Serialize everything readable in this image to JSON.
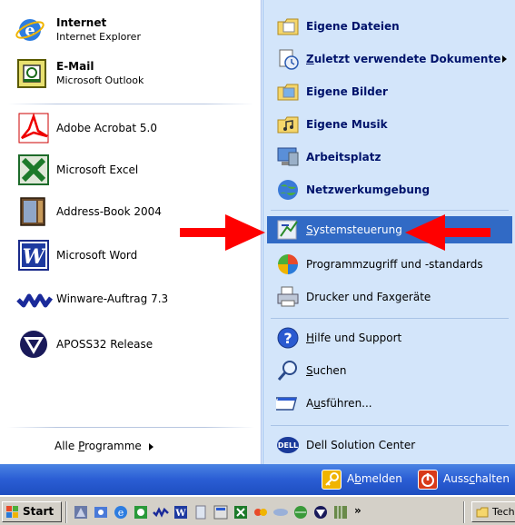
{
  "left_pinned": [
    {
      "title": "Internet",
      "subtitle": "Internet Explorer"
    },
    {
      "title": "E-Mail",
      "subtitle": "Microsoft Outlook"
    }
  ],
  "left_recent": [
    {
      "label": "Adobe Acrobat 5.0"
    },
    {
      "label": "Microsoft Excel"
    },
    {
      "label": "Address-Book 2004"
    },
    {
      "label": "Microsoft Word"
    },
    {
      "label": "Winware-Auftrag 7.3"
    },
    {
      "label": "APOSS32 Release"
    }
  ],
  "all_programs": {
    "pre": "Alle ",
    "key": "P",
    "post": "rogramme"
  },
  "right_items": {
    "eigene_dateien": "Eigene Dateien",
    "zuletzt_pre": "Z",
    "zuletzt_post": "uletzt verwendete Dokumente",
    "eigene_bilder": "Eigene Bilder",
    "eigene_musik": "Eigene Musik",
    "arbeitsplatz": "Arbeitsplatz",
    "netzwerk": "Netzwerkumgebung",
    "sys_pre": "S",
    "sys_post": "ystemsteuerung",
    "programmzugriff": "Programmzugriff und -standards",
    "drucker": "Drucker und Faxgeräte",
    "hilfe_pre": "H",
    "hilfe_post": "ilfe und Support",
    "suchen_pre": "S",
    "suchen_post": "uchen",
    "ausfuehren_pre": "A",
    "ausfuehren_key": "u",
    "ausfuehren_post": "sführen...",
    "dell": "Dell Solution Center"
  },
  "bottom": {
    "abmelden_pre": "A",
    "abmelden_key": "b",
    "abmelden_post": "melden",
    "ausschalten_pre": "Auss",
    "ausschalten_key": "c",
    "ausschalten_post": "halten"
  },
  "taskbar": {
    "start": "Start",
    "overflow": "»",
    "task_button": "Techr"
  },
  "colors": {
    "highlight": "#316ac5",
    "right_bg": "#d3e5fa",
    "bottom_bar": "#2a5dd4",
    "arrow": "#ff0000"
  }
}
